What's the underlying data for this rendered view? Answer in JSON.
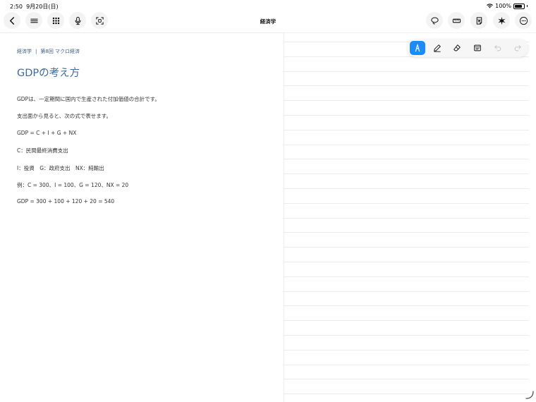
{
  "status": {
    "time": "2:50",
    "date": "9月20日(日)",
    "battery": "100%"
  },
  "header": {
    "title": "経済学",
    "left_icons": [
      "back-chevron-icon",
      "menu-icon",
      "grid-icon",
      "microphone-icon",
      "scan-icon"
    ],
    "right_icons": [
      "lasso-icon",
      "ruler-icon",
      "sticker-icon",
      "sparkle-icon",
      "more-icon"
    ]
  },
  "document": {
    "breadcrumb": [
      "経済学",
      "第8回 マクロ経済"
    ],
    "breadcrumb_separator": "|",
    "title": "GDPの考え方",
    "lines": [
      "GDPは、一定期間に国内で生産された付加価値の合計です。",
      "支出面から見ると、次の式で表せます。",
      "GDP = C + I + G + NX",
      "C：民間最終消費支出",
      "I：投資　G：政府支出　NX：純輸出",
      "例：C = 300、I = 100、G = 120、NX = 20",
      "GDP = 300 + 100 + 120 + 20 = 540"
    ]
  },
  "pen_toolbar": {
    "tools": [
      "fountain-pen-icon",
      "pencil-icon",
      "eraser-icon",
      "text-box-icon",
      "undo-icon",
      "redo-icon"
    ],
    "active_tool": "fountain-pen-icon",
    "accent_color": "#1a8cff"
  },
  "colors": {
    "title_blue": "#3b6a9e",
    "breadcrumb_blue": "#3a5f88"
  }
}
